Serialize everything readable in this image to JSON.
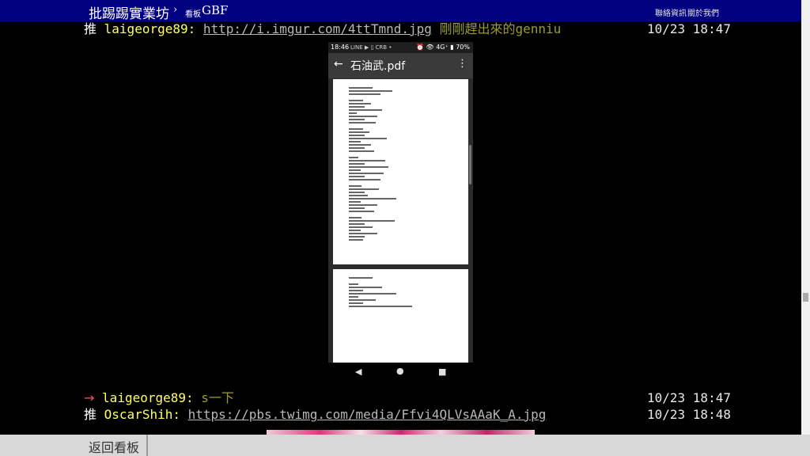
{
  "header": {
    "site_name": "批踢踢實業坊",
    "separator": "›",
    "board_label": "看板",
    "board_name": "GBF",
    "links": [
      "聯絡資訊",
      "關於我們"
    ]
  },
  "pushes": [
    {
      "tag": "推",
      "user": "laigeorge89",
      "link": "http://i.imgur.com/4ttTmnd.jpg",
      "message": " 剛剛趕出來的genniu",
      "time": "10/23 18:47"
    },
    {
      "tag": "→",
      "user": "laigeorge89",
      "message": " s一下",
      "time": "10/23 18:47"
    },
    {
      "tag": "推",
      "user": "OscarShih",
      "link": "https://pbs.twimg.com/media/Ffvi4QLVsAAaK_A.jpg",
      "time": "10/23 18:48"
    }
  ],
  "phone": {
    "status_time": "18:46",
    "status_icons": "LINE ▶ ▯ CRB •",
    "status_right": "⏰ 👁 4G⁺ ▮ 70%",
    "file_title": "石油武.pdf",
    "back_icon": "arrow-left-icon",
    "more_icon": "more-vert-icon"
  },
  "footer": {
    "back_label": "返回看板"
  },
  "colors": {
    "header_bg": "#000080",
    "user": "#ffff66",
    "message": "#9b9b30",
    "arrow_tag": "#ff5050"
  }
}
